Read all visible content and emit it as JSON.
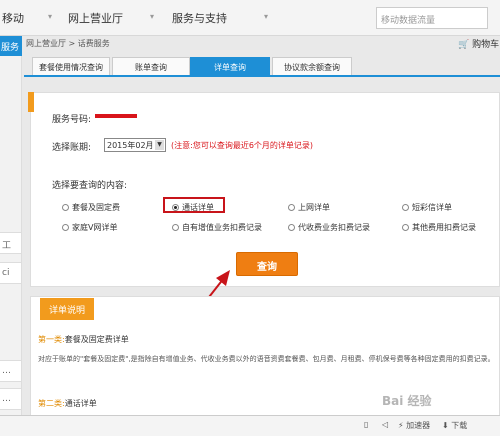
{
  "top_nav": {
    "item_left": "移动",
    "item_online": "网上营业厅",
    "item_service": "服务与支持",
    "search_placeholder": "移动数据流量"
  },
  "left_sidebar": {
    "active_label": "服务",
    "tab_labels": [
      "工",
      "ci",
      "…",
      "…"
    ]
  },
  "breadcrumb": "网上营业厅 > 话费服务",
  "cart_label": "购物车",
  "tabs": [
    "套餐使用情况查询",
    "账单查询",
    "详单查询",
    "协议款余额查询"
  ],
  "active_tab_index": 2,
  "form": {
    "service_number_label": "服务号码:",
    "billing_month_label": "选择账期:",
    "billing_month_value": "2015年02月",
    "note": "(注意:您可以查询最近6个月的详单记录)",
    "content_label": "选择要查询的内容:",
    "options": [
      "套餐及固定费",
      "通话详单",
      "上网详单",
      "短彩信详单",
      "家庭V网详单",
      "自有增值业务扣费记录",
      "代收费业务扣费记录",
      "其他费用扣费记录"
    ],
    "selected_option_index": 1,
    "query_button": "查询"
  },
  "details": {
    "tag": "详单说明",
    "cat1_prefix": "第一类:",
    "cat1_title": "套餐及固定费详单",
    "cat1_desc": "对应于账单的\"套餐及固定费\",是指除自有增值业务、代收业务费以外的语音资费套餐费、包月费、月租费、停机保号费等各种固定费用的扣费记录。",
    "cat2_prefix": "第二类:",
    "cat2_title": "通话详单"
  },
  "bottom_bar": {
    "item_accelerate": "加速器",
    "item_download": "下载"
  },
  "watermark": "Bai 经验",
  "colors": {
    "accent_blue": "#1e8fd6",
    "accent_orange": "#ef7e12",
    "highlight_red": "#c8141a"
  }
}
